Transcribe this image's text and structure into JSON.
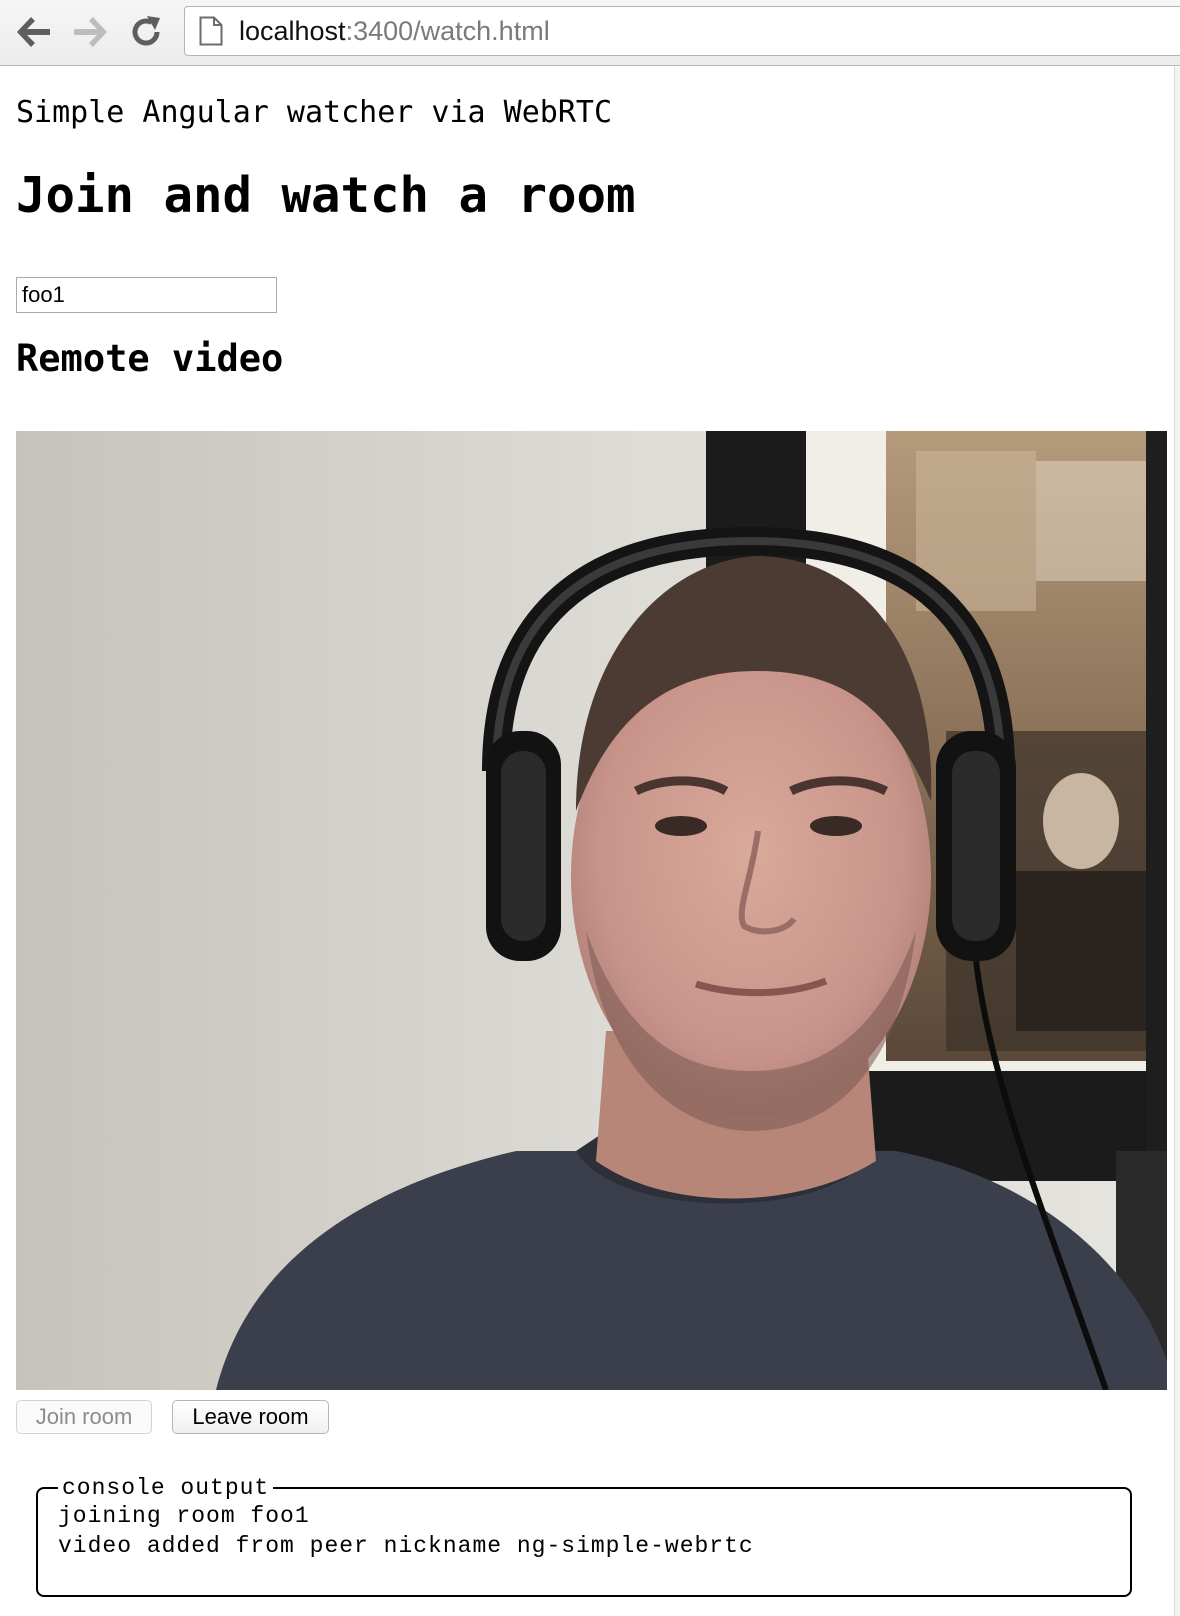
{
  "browser": {
    "url_host": "localhost",
    "url_path": ":3400/watch.html",
    "icons": {
      "back": "back-arrow-icon",
      "forward": "forward-arrow-icon",
      "reload": "reload-icon",
      "page": "page-icon"
    }
  },
  "page": {
    "subtitle": "Simple Angular watcher via WebRTC",
    "heading": "Join and watch a room",
    "room_input_value": "foo1",
    "video_heading": "Remote video",
    "join_button": "Join room",
    "leave_button": "Leave room"
  },
  "console": {
    "legend": "console output",
    "lines": [
      "joining room foo1",
      "video added from peer nickname ng-simple-webrtc"
    ]
  },
  "colors": {
    "disabled_text": "#8c8c8c",
    "url_path_text": "#7a7a7a"
  }
}
